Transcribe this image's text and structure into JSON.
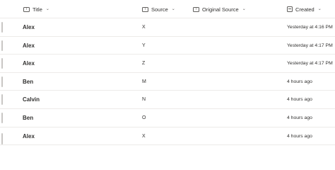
{
  "columns": {
    "title": "Title",
    "source": "Source",
    "original_source": "Original Source",
    "created": "Created"
  },
  "rows": [
    {
      "title": "Alex",
      "source": "X",
      "created": "Yesterday at 4:16 PM"
    },
    {
      "title": "Alex",
      "source": "Y",
      "created": "Yesterday at 4:17 PM"
    },
    {
      "title": "Alex",
      "source": "Z",
      "created": "Yesterday at 4:17 PM"
    },
    {
      "title": "Ben",
      "source": "M",
      "created": "4 hours ago"
    },
    {
      "title": "Calvin",
      "source": "N",
      "created": "4 hours ago"
    },
    {
      "title": "Ben",
      "source": "O",
      "created": "4 hours ago"
    },
    {
      "title": "Alex",
      "source": "X",
      "created": "4 hours ago"
    }
  ]
}
